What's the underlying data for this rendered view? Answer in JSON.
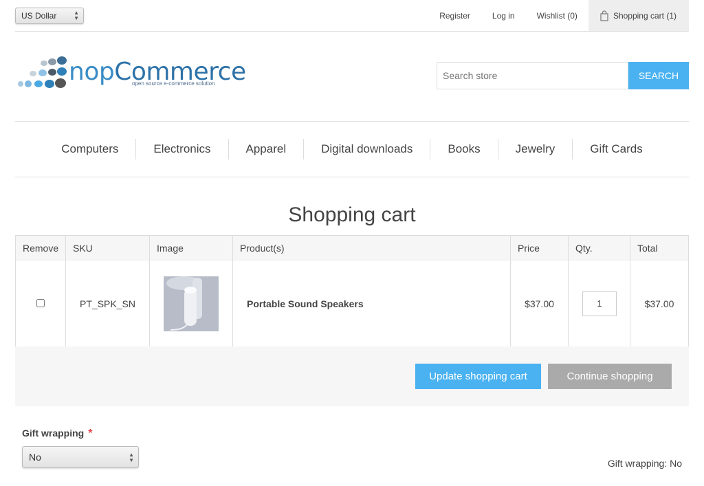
{
  "header": {
    "currency": "US Dollar",
    "links": {
      "register": "Register",
      "login": "Log in",
      "wishlist": "Wishlist (0)",
      "cart": "Shopping cart (1)"
    }
  },
  "logo": {
    "word_nop": "nop",
    "word_commerce": "Commerce",
    "tagline": "open source e-commerce solution"
  },
  "search": {
    "placeholder": "Search store",
    "button": "SEARCH"
  },
  "menu": [
    "Computers",
    "Electronics",
    "Apparel",
    "Digital downloads",
    "Books",
    "Jewelry",
    "Gift Cards"
  ],
  "page_title": "Shopping cart",
  "cart": {
    "columns": [
      "Remove",
      "SKU",
      "Image",
      "Product(s)",
      "Price",
      "Qty.",
      "Total"
    ],
    "rows": [
      {
        "sku": "PT_SPK_SN",
        "product": "Portable Sound Speakers",
        "price": "$37.00",
        "qty": "1",
        "total": "$37.00"
      }
    ]
  },
  "actions": {
    "update": "Update shopping cart",
    "continue": "Continue shopping"
  },
  "gift": {
    "label": "Gift wrapping",
    "required": "*",
    "value": "No",
    "summary": "Gift wrapping: No"
  },
  "colors": {
    "accent": "#4ab2f1",
    "secondary_button": "#aaaaaa",
    "required": "#e4434b"
  }
}
